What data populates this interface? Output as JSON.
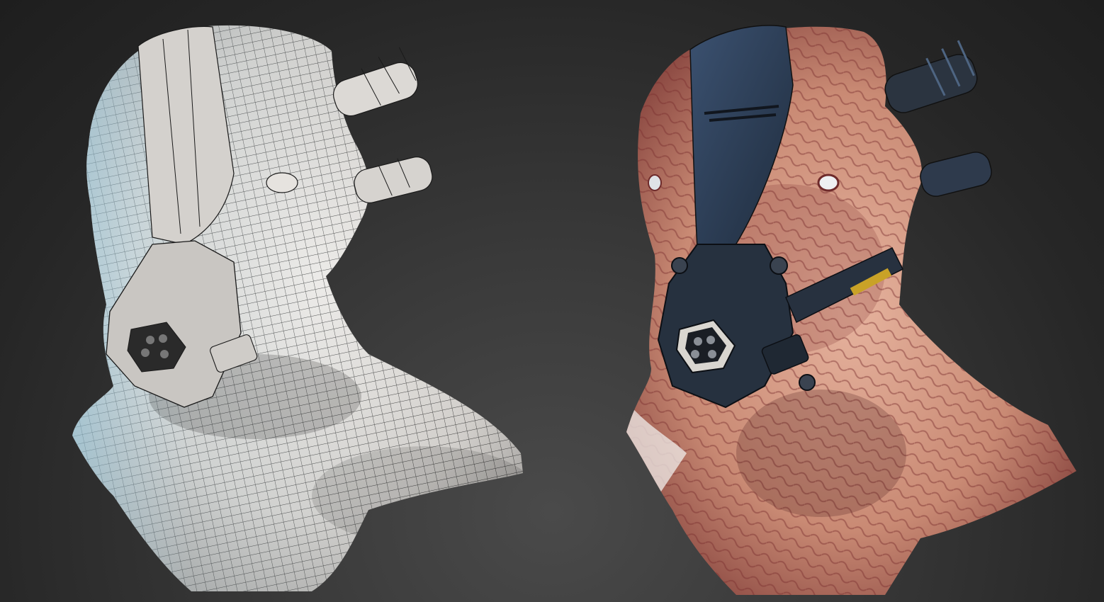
{
  "viewport": {
    "background_top": "#1e1e1e",
    "background_bottom": "#4a4a4a"
  },
  "left_model": {
    "render_mode": "wireframe-on-shaded",
    "base_color": "#d9d6d2",
    "wire_color": "#1a1a1a",
    "rim_light_color": "#8fd3f0"
  },
  "right_model": {
    "render_mode": "textured",
    "skin_color": "#d9a08a",
    "skin_shadow_color": "#7a2e2e",
    "strap_color": "#2e4058",
    "mask_color": "#26313f",
    "eye_color": "#eef0f2",
    "decal_color": "#c9a227"
  }
}
